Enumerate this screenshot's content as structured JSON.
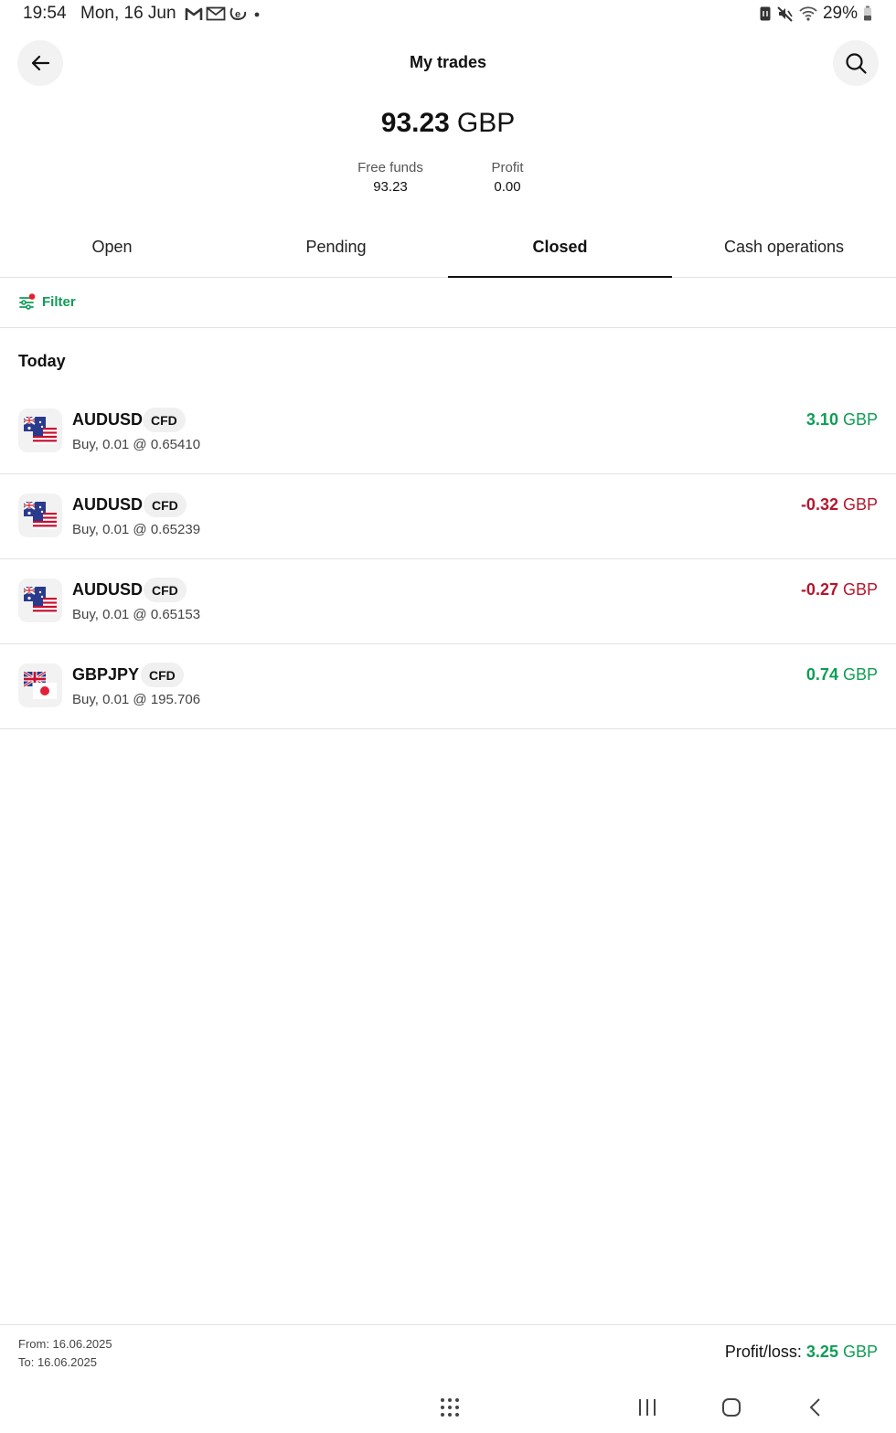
{
  "status_bar": {
    "time": "19:54",
    "date": "Mon, 16 Jun",
    "battery": "29%",
    "notification_icons": [
      "gmail-icon",
      "gmail-outline-icon",
      "app-e-icon",
      "more-dot-icon"
    ],
    "system_icons": [
      "nfc-icon",
      "mute-icon",
      "wifi-icon",
      "battery-icon"
    ]
  },
  "header": {
    "title": "My trades",
    "back_icon": "arrow-left-icon",
    "search_icon": "search-icon"
  },
  "balance": {
    "amount": "93.23",
    "currency": "GBP",
    "free_funds_label": "Free funds",
    "free_funds_value": "93.23",
    "profit_label": "Profit",
    "profit_value": "0.00"
  },
  "tabs": [
    {
      "label": "Open",
      "active": false
    },
    {
      "label": "Pending",
      "active": false
    },
    {
      "label": "Closed",
      "active": true
    },
    {
      "label": "Cash operations",
      "active": false
    }
  ],
  "filter": {
    "label": "Filter",
    "icon": "sliders-icon"
  },
  "section": {
    "title": "Today"
  },
  "trades": [
    {
      "symbol": "AUDUSD",
      "badge": "CFD",
      "details": "Buy, 0.01 @ 0.65410",
      "pl_value": "3.10",
      "pl_currency": "GBP",
      "pl_sign": "positive",
      "flags": "au-us"
    },
    {
      "symbol": "AUDUSD",
      "badge": "CFD",
      "details": "Buy, 0.01 @ 0.65239",
      "pl_value": "-0.32",
      "pl_currency": "GBP",
      "pl_sign": "negative",
      "flags": "au-us"
    },
    {
      "symbol": "AUDUSD",
      "badge": "CFD",
      "details": "Buy, 0.01 @ 0.65153",
      "pl_value": "-0.27",
      "pl_currency": "GBP",
      "pl_sign": "negative",
      "flags": "au-us"
    },
    {
      "symbol": "GBPJPY",
      "badge": "CFD",
      "details": "Buy, 0.01 @ 195.706",
      "pl_value": "0.74",
      "pl_currency": "GBP",
      "pl_sign": "positive",
      "flags": "gb-jp"
    }
  ],
  "footer": {
    "from": "From: 16.06.2025",
    "to": "To: 16.06.2025",
    "pl_label": "Profit/loss:",
    "pl_value": "3.25",
    "pl_currency": "GBP"
  },
  "nav_bar": {
    "icons": [
      "apps-grid-icon",
      "recents-icon",
      "home-icon",
      "back-icon"
    ]
  },
  "colors": {
    "positive": "#0e9d55",
    "negative": "#b5172e",
    "accent": "#0e9d55"
  }
}
